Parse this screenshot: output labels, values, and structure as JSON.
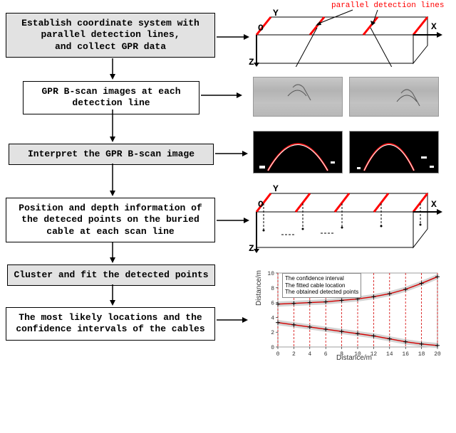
{
  "steps": {
    "s1": "Establish coordinate system with\nparallel detection lines,\nand collect GPR data",
    "s2": "GPR B-scan images at each\ndetection line",
    "s3": "Interpret the GPR B-scan image",
    "s4": "Position and depth information of\nthe deteced points on the buried\ncable at each scan line",
    "s5": "Cluster and fit the detected points",
    "s6": "The most likely locations and the\nconfidence intervals of the cables"
  },
  "labels": {
    "parallel_detection_lines": "parallel detection lines",
    "axis_x": "X",
    "axis_y": "Y",
    "axis_z": "Z",
    "origin": "O"
  },
  "chart_data": {
    "type": "line",
    "title": "",
    "xlabel": "Distance/m",
    "ylabel": "Distance/m",
    "xlim": [
      0,
      20
    ],
    "ylim": [
      0,
      10
    ],
    "xticks": [
      0,
      2,
      4,
      6,
      8,
      10,
      12,
      14,
      16,
      18,
      20
    ],
    "yticks": [
      0,
      2,
      4,
      6,
      8,
      10
    ],
    "legend": {
      "entries": [
        "The confidence interval",
        "The fitted cable location",
        "The obtained detected points"
      ]
    },
    "series": [
      {
        "name": "upper_cable_fit",
        "x": [
          0,
          2,
          4,
          6,
          8,
          10,
          12,
          14,
          16,
          18,
          20
        ],
        "y": [
          5.8,
          5.9,
          6.0,
          6.1,
          6.3,
          6.5,
          6.8,
          7.2,
          7.8,
          8.6,
          9.5
        ]
      },
      {
        "name": "lower_cable_fit",
        "x": [
          0,
          2,
          4,
          6,
          8,
          10,
          12,
          14,
          16,
          18,
          20
        ],
        "y": [
          3.3,
          3.0,
          2.7,
          2.4,
          2.1,
          1.8,
          1.5,
          1.1,
          0.7,
          0.4,
          0.2
        ]
      },
      {
        "name": "detected_points_upper",
        "x": [
          0,
          2,
          4,
          6,
          8,
          10,
          12,
          14,
          16,
          18,
          20
        ],
        "y": [
          5.8,
          5.9,
          6.0,
          6.1,
          6.3,
          6.5,
          6.8,
          7.2,
          7.8,
          8.6,
          9.5
        ]
      },
      {
        "name": "detected_points_lower",
        "x": [
          0,
          2,
          4,
          6,
          8,
          10,
          12,
          14,
          16,
          18,
          20
        ],
        "y": [
          3.3,
          3.0,
          2.7,
          2.4,
          2.1,
          1.8,
          1.5,
          1.1,
          0.7,
          0.4,
          0.2
        ]
      }
    ],
    "detection_line_x": [
      0,
      2,
      4,
      6,
      8,
      10,
      12,
      14,
      16,
      18,
      20
    ]
  }
}
